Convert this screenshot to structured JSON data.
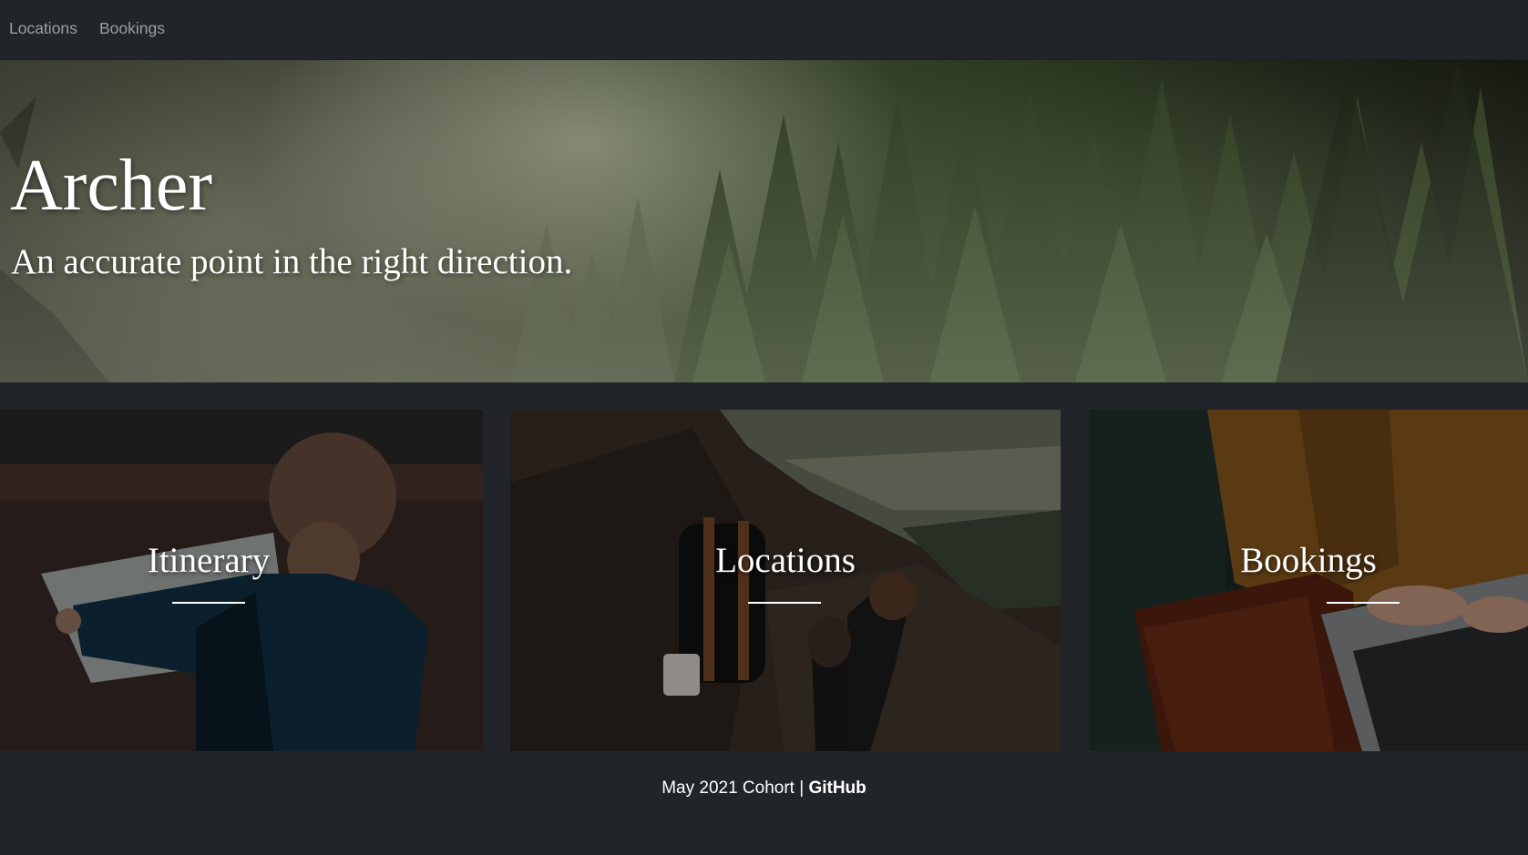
{
  "nav": {
    "items": [
      {
        "label": "Locations"
      },
      {
        "label": "Bookings"
      }
    ]
  },
  "hero": {
    "title": "Archer",
    "subtitle": "An accurate point in the right direction."
  },
  "cards": [
    {
      "title": "Itinerary"
    },
    {
      "title": "Locations"
    },
    {
      "title": "Bookings"
    }
  ],
  "footer": {
    "text": "May 2021 Cohort | ",
    "link_label": "GitHub"
  },
  "colors": {
    "background": "#212529",
    "text": "#ffffff",
    "nav_link": "rgba(255,255,255,0.55)"
  }
}
